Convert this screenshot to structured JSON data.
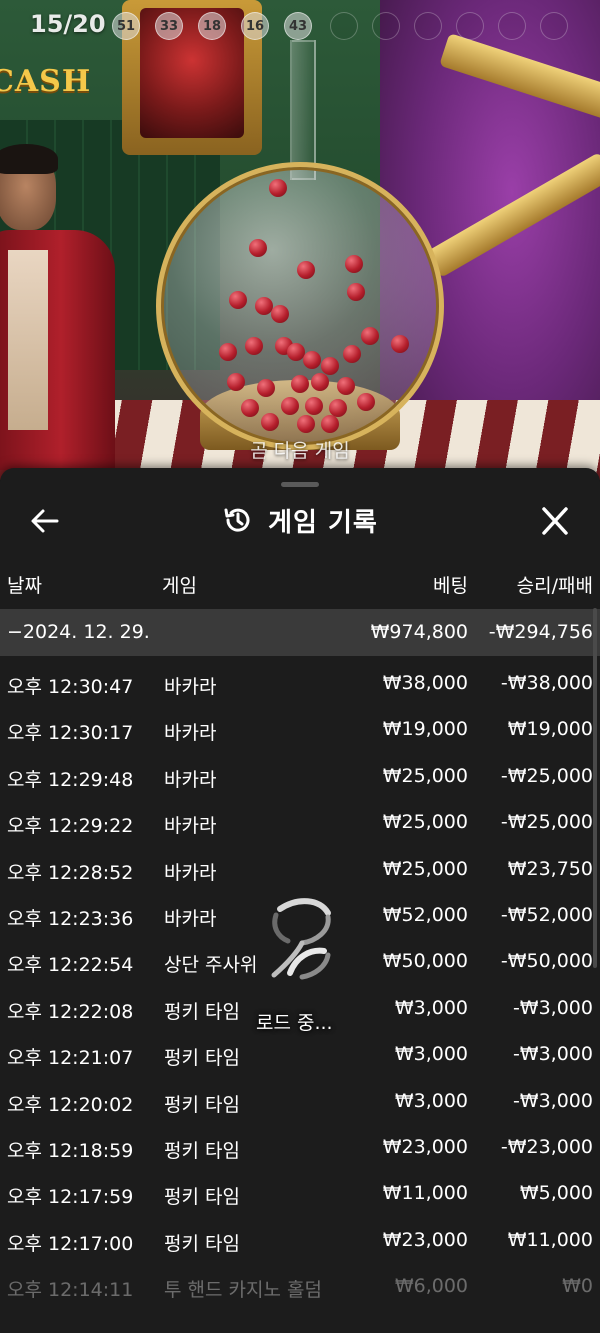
{
  "stage": {
    "round_counter": "15/20",
    "drawn_balls": [
      "51",
      "33",
      "18",
      "16",
      "43"
    ],
    "caption": "곧 다음 게임",
    "sign_text": "CASH"
  },
  "panel": {
    "title": "게임 기록",
    "back_icon": "arrow-left-icon",
    "history_icon": "history-icon",
    "close_icon": "close-icon",
    "columns": {
      "date": "날짜",
      "game": "게임",
      "bet": "베팅",
      "result": "승리/패배"
    },
    "summary": {
      "date": "−2024. 12. 29.",
      "bet": "₩974,800",
      "result": "-₩294,756"
    },
    "rows": [
      {
        "time": "오후 12:30:47",
        "game": "바카라",
        "bet": "₩38,000",
        "result": "-₩38,000"
      },
      {
        "time": "오후 12:30:17",
        "game": "바카라",
        "bet": "₩19,000",
        "result": "₩19,000"
      },
      {
        "time": "오후 12:29:48",
        "game": "바카라",
        "bet": "₩25,000",
        "result": "-₩25,000"
      },
      {
        "time": "오후 12:29:22",
        "game": "바카라",
        "bet": "₩25,000",
        "result": "-₩25,000"
      },
      {
        "time": "오후 12:28:52",
        "game": "바카라",
        "bet": "₩25,000",
        "result": "₩23,750"
      },
      {
        "time": "오후 12:23:36",
        "game": "바카라",
        "bet": "₩52,000",
        "result": "-₩52,000"
      },
      {
        "time": "오후 12:22:54",
        "game": "상단 주사위",
        "bet": "₩50,000",
        "result": "-₩50,000"
      },
      {
        "time": "오후 12:22:08",
        "game": "펑키 타임",
        "bet": "₩3,000",
        "result": "-₩3,000"
      },
      {
        "time": "오후 12:21:07",
        "game": "펑키 타임",
        "bet": "₩3,000",
        "result": "-₩3,000"
      },
      {
        "time": "오후 12:20:02",
        "game": "펑키 타임",
        "bet": "₩3,000",
        "result": "-₩3,000"
      },
      {
        "time": "오후 12:18:59",
        "game": "펑키 타임",
        "bet": "₩23,000",
        "result": "-₩23,000"
      },
      {
        "time": "오후 12:17:59",
        "game": "펑키 타임",
        "bet": "₩11,000",
        "result": "₩5,000"
      },
      {
        "time": "오후 12:17:00",
        "game": "펑키 타임",
        "bet": "₩23,000",
        "result": "₩11,000"
      },
      {
        "time": "오후 12:14:11",
        "game": "투 핸드 카지노 홀덤",
        "bet": "₩6,000",
        "result": "₩0"
      }
    ],
    "loading_text": "로드 중..."
  }
}
